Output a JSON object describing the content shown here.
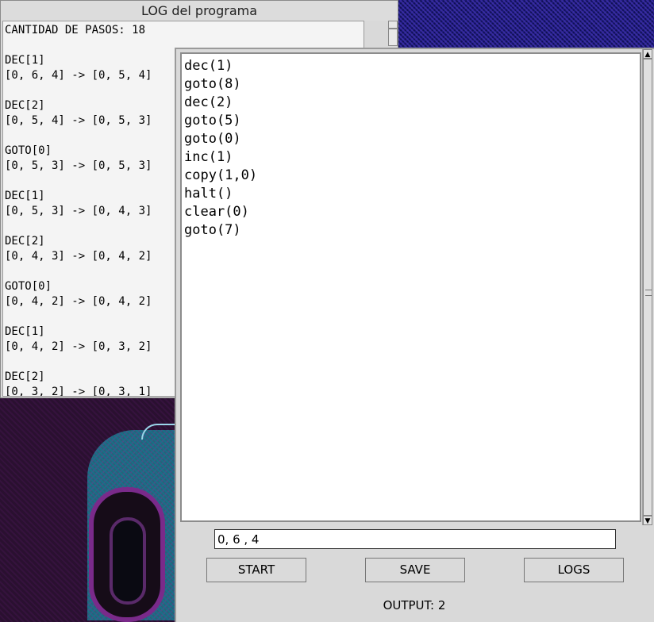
{
  "log_window": {
    "title": "LOG del programa",
    "text": "CANTIDAD DE PASOS: 18\n\nDEC[1]\n[0, 6, 4] -> [0, 5, 4]\n\nDEC[2]\n[0, 5, 4] -> [0, 5, 3]\n\nGOTO[0]\n[0, 5, 3] -> [0, 5, 3]\n\nDEC[1]\n[0, 5, 3] -> [0, 4, 3]\n\nDEC[2]\n[0, 4, 3] -> [0, 4, 2]\n\nGOTO[0]\n[0, 4, 2] -> [0, 4, 2]\n\nDEC[1]\n[0, 4, 2] -> [0, 3, 2]\n\nDEC[2]\n[0, 3, 2] -> [0, 3, 1]"
  },
  "editor": {
    "code": "dec(1)\ngoto(8)\ndec(2)\ngoto(5)\ngoto(0)\ninc(1)\ncopy(1,0)\nhalt()\nclear(0)\ngoto(7)"
  },
  "input": {
    "value": "0, 6 , 4"
  },
  "buttons": {
    "start": "START",
    "save": "SAVE",
    "logs": "LOGS"
  },
  "output": {
    "text": "OUTPUT: 2"
  }
}
